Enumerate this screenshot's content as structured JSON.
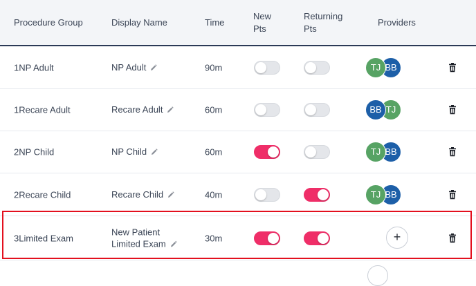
{
  "headers": {
    "procedure_group": "Procedure Group",
    "display_name": "Display Name",
    "time": "Time",
    "new_pts_line1": "New",
    "new_pts_line2": "Pts",
    "returning_pts_line1": "Returning",
    "returning_pts_line2": "Pts",
    "providers": "Providers"
  },
  "colors": {
    "toggle_on": "#ef2e68",
    "toggle_off": "#e4e6ea",
    "avatar_green": "#57a364",
    "avatar_blue": "#1d5fa8",
    "highlight": "#e3101e",
    "header_rule": "#2c3a57"
  },
  "rows": [
    {
      "procedure_group": "1NP Adult",
      "display_name_line1": "NP Adult",
      "display_name_line2": "",
      "time": "90m",
      "new_pts": false,
      "returning_pts": false,
      "providers": [
        "TJ",
        "BB"
      ]
    },
    {
      "procedure_group": "1Recare Adult",
      "display_name_line1": "Recare Adult",
      "display_name_line2": "",
      "time": "60m",
      "new_pts": false,
      "returning_pts": false,
      "providers": [
        "BB",
        "TJ"
      ]
    },
    {
      "procedure_group": "2NP Child",
      "display_name_line1": "NP Child",
      "display_name_line2": "",
      "time": "60m",
      "new_pts": true,
      "returning_pts": false,
      "providers": [
        "TJ",
        "BB"
      ]
    },
    {
      "procedure_group": "2Recare Child",
      "display_name_line1": "Recare Child",
      "display_name_line2": "",
      "time": "40m",
      "new_pts": false,
      "returning_pts": true,
      "providers": [
        "TJ",
        "BB"
      ]
    },
    {
      "procedure_group": "3Limited Exam",
      "display_name_line1": "New Patient",
      "display_name_line2": "Limited Exam",
      "time": "30m",
      "new_pts": true,
      "returning_pts": true,
      "providers": [],
      "add_provider_label": "+"
    }
  ]
}
